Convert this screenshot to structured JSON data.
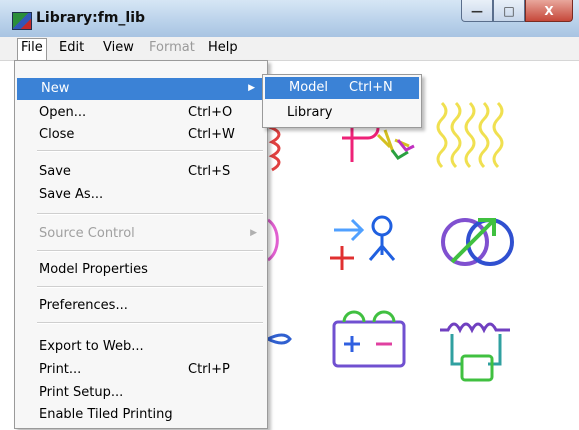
{
  "window": {
    "title": "Library:fm_lib",
    "minimize": "—",
    "maximize": "□",
    "close": "X"
  },
  "menubar": [
    "File",
    "Edit",
    "View",
    "Format",
    "Help"
  ],
  "file_menu": {
    "new": "New",
    "open": {
      "label": "Open...",
      "shortcut": "Ctrl+O"
    },
    "close": {
      "label": "Close",
      "shortcut": "Ctrl+W"
    },
    "save": {
      "label": "Save",
      "shortcut": "Ctrl+S"
    },
    "save_as": "Save As...",
    "source_control": "Source Control",
    "model_properties": "Model Properties",
    "preferences": "Preferences...",
    "export_web": "Export to Web...",
    "print": {
      "label": "Print...",
      "shortcut": "Ctrl+P"
    },
    "print_setup": "Print Setup...",
    "tiled": "Enable Tiled Printing"
  },
  "new_submenu": {
    "model": {
      "label": "Model",
      "shortcut": "Ctrl+N"
    },
    "library": "Library"
  },
  "colors": {
    "highlight": "#3b82d6"
  }
}
